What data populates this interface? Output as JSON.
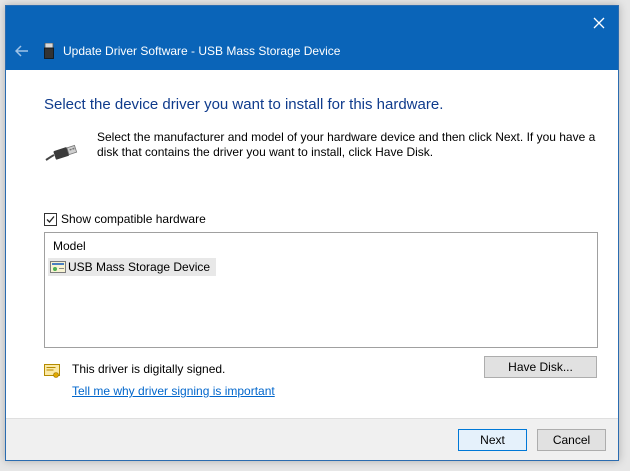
{
  "window": {
    "title": "Update Driver Software - USB Mass Storage Device",
    "close_icon": "close-icon",
    "back_icon": "back-arrow-icon"
  },
  "main": {
    "heading": "Select the device driver you want to install for this hardware.",
    "description": "Select the manufacturer and model of your hardware device and then click Next. If you have a disk that contains the driver you want to install, click Have Disk.",
    "show_compatible": {
      "label": "Show compatible hardware",
      "checked": true
    },
    "list": {
      "header": "Model",
      "items": [
        {
          "label": "USB Mass Storage Device",
          "selected": true
        }
      ]
    },
    "signed_text": "This driver is digitally signed.",
    "signing_link": "Tell me why driver signing is important",
    "have_disk_label": "Have Disk..."
  },
  "footer": {
    "next_label": "Next",
    "cancel_label": "Cancel"
  },
  "colors": {
    "titlebar": "#0a64b8",
    "heading": "#0f3b8c",
    "link": "#0066cc"
  }
}
